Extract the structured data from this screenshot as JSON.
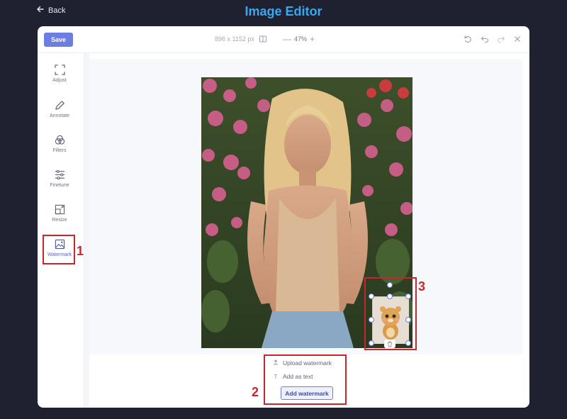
{
  "header": {
    "back_label": "Back",
    "title": "Image Editor"
  },
  "toolbar": {
    "save_label": "Save",
    "dimensions": "896 x 1152 px",
    "zoom": "47%",
    "zoom_out": "—",
    "zoom_in": "+"
  },
  "sidebar": {
    "items": [
      {
        "label": "Adjust",
        "icon": "crop-icon"
      },
      {
        "label": "Annotate",
        "icon": "pencil-icon"
      },
      {
        "label": "Filters",
        "icon": "filters-icon"
      },
      {
        "label": "Finetune",
        "icon": "sliders-icon"
      },
      {
        "label": "Resize",
        "icon": "resize-icon"
      },
      {
        "label": "Watermark",
        "icon": "image-icon",
        "active": true
      }
    ]
  },
  "watermark_menu": {
    "upload_label": "Upload watermark",
    "text_label": "Add as text",
    "text_icon": "T",
    "add_button": "Add watermark"
  },
  "annotations": {
    "one": "1",
    "two": "2",
    "three": "3"
  },
  "colors": {
    "accent": "#6c7ee1",
    "title": "#3aa8f0",
    "annotation": "#c9262c",
    "background": "#1f2130"
  }
}
